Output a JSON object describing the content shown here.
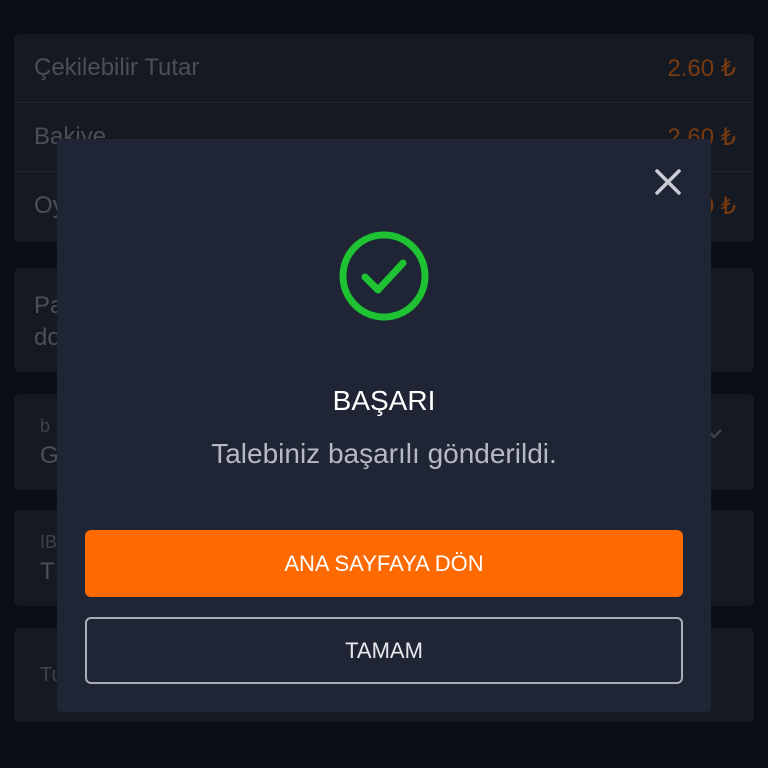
{
  "background": {
    "balances": [
      {
        "label": "Çekilebilir Tutar",
        "value": "2.60 ₺"
      },
      {
        "label": "Bakiye",
        "value": "2.60 ₺"
      },
      {
        "label": "Oy",
        "value": "0 ₺"
      }
    ],
    "info_text_line1": "Pa",
    "info_text_line2": "do",
    "bank_field": {
      "label": "b",
      "value": "G"
    },
    "iban_field": {
      "label": "IB",
      "value": "T"
    },
    "amount_field": {
      "label": "Tu"
    }
  },
  "modal": {
    "title": "BAŞARI",
    "message": "Talebiniz başarılı gönderildi.",
    "primary_button": "ANA SAYFAYA DÖN",
    "secondary_button": "TAMAM",
    "icons": {
      "close": "close-icon",
      "success": "check-circle-icon"
    },
    "colors": {
      "accent": "#ff6a00",
      "success": "#1ec232",
      "modal_bg": "#1f2535"
    }
  }
}
